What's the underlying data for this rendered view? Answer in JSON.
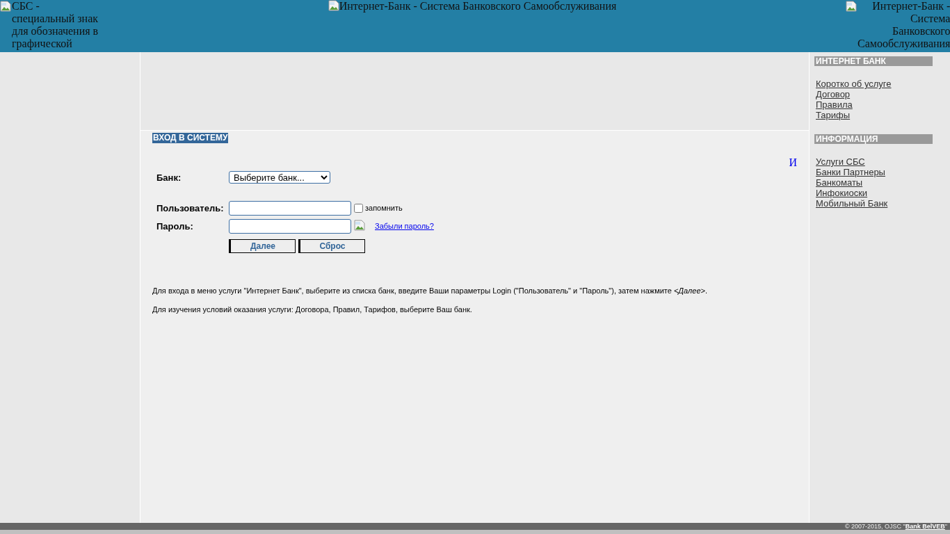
{
  "header": {
    "logo_alt": "СБС - специальный знак для обозначения в графической",
    "title_alt": "Интернет-Банк - Система Банковского Самообслуживания",
    "right_alt": "Интернет-Банк - Система Банковского Самообслуживания"
  },
  "login": {
    "heading": "ВХОД В СИСТЕМУ",
    "corner_mark": "И",
    "bank_label": "Банк:",
    "bank_value": "Выберите банк...",
    "user_label": "Пользователь:",
    "remember": {
      "label": "запомнить",
      "checked": false
    },
    "password_label": "Пароль:",
    "forgot_link": "Забыли пароль?",
    "buttons": [
      "Далее",
      "Сброс"
    ]
  },
  "instructions": [
    "Для входа в меню услуги \"Интернет Банк\", выберите из списка банк, введите Ваши параметры Login (\"Пользователь\" и \"Пароль\"), затем нажмите *<Далее>*.",
    "Для изучения условий оказания услуги: Договора, Правил, Тарифов, выберите Ваш банк."
  ],
  "sidebar": {
    "sections": [
      {
        "heading": "ИНТЕРНЕТ БАНК",
        "links": [
          "Коротко об услуге",
          "Договор",
          "Правила",
          "Тарифы"
        ]
      },
      {
        "heading": "ИНФОРМАЦИЯ",
        "links": [
          "Услуги СБС",
          "Банки Партнеры",
          "Банкоматы",
          "Инфокиоски",
          "Мобильный Банк"
        ]
      }
    ]
  },
  "footer": {
    "text_before": "© 2007-2015, OJSC \"",
    "link": "Bank BelVEB",
    "text_after": "\""
  }
}
